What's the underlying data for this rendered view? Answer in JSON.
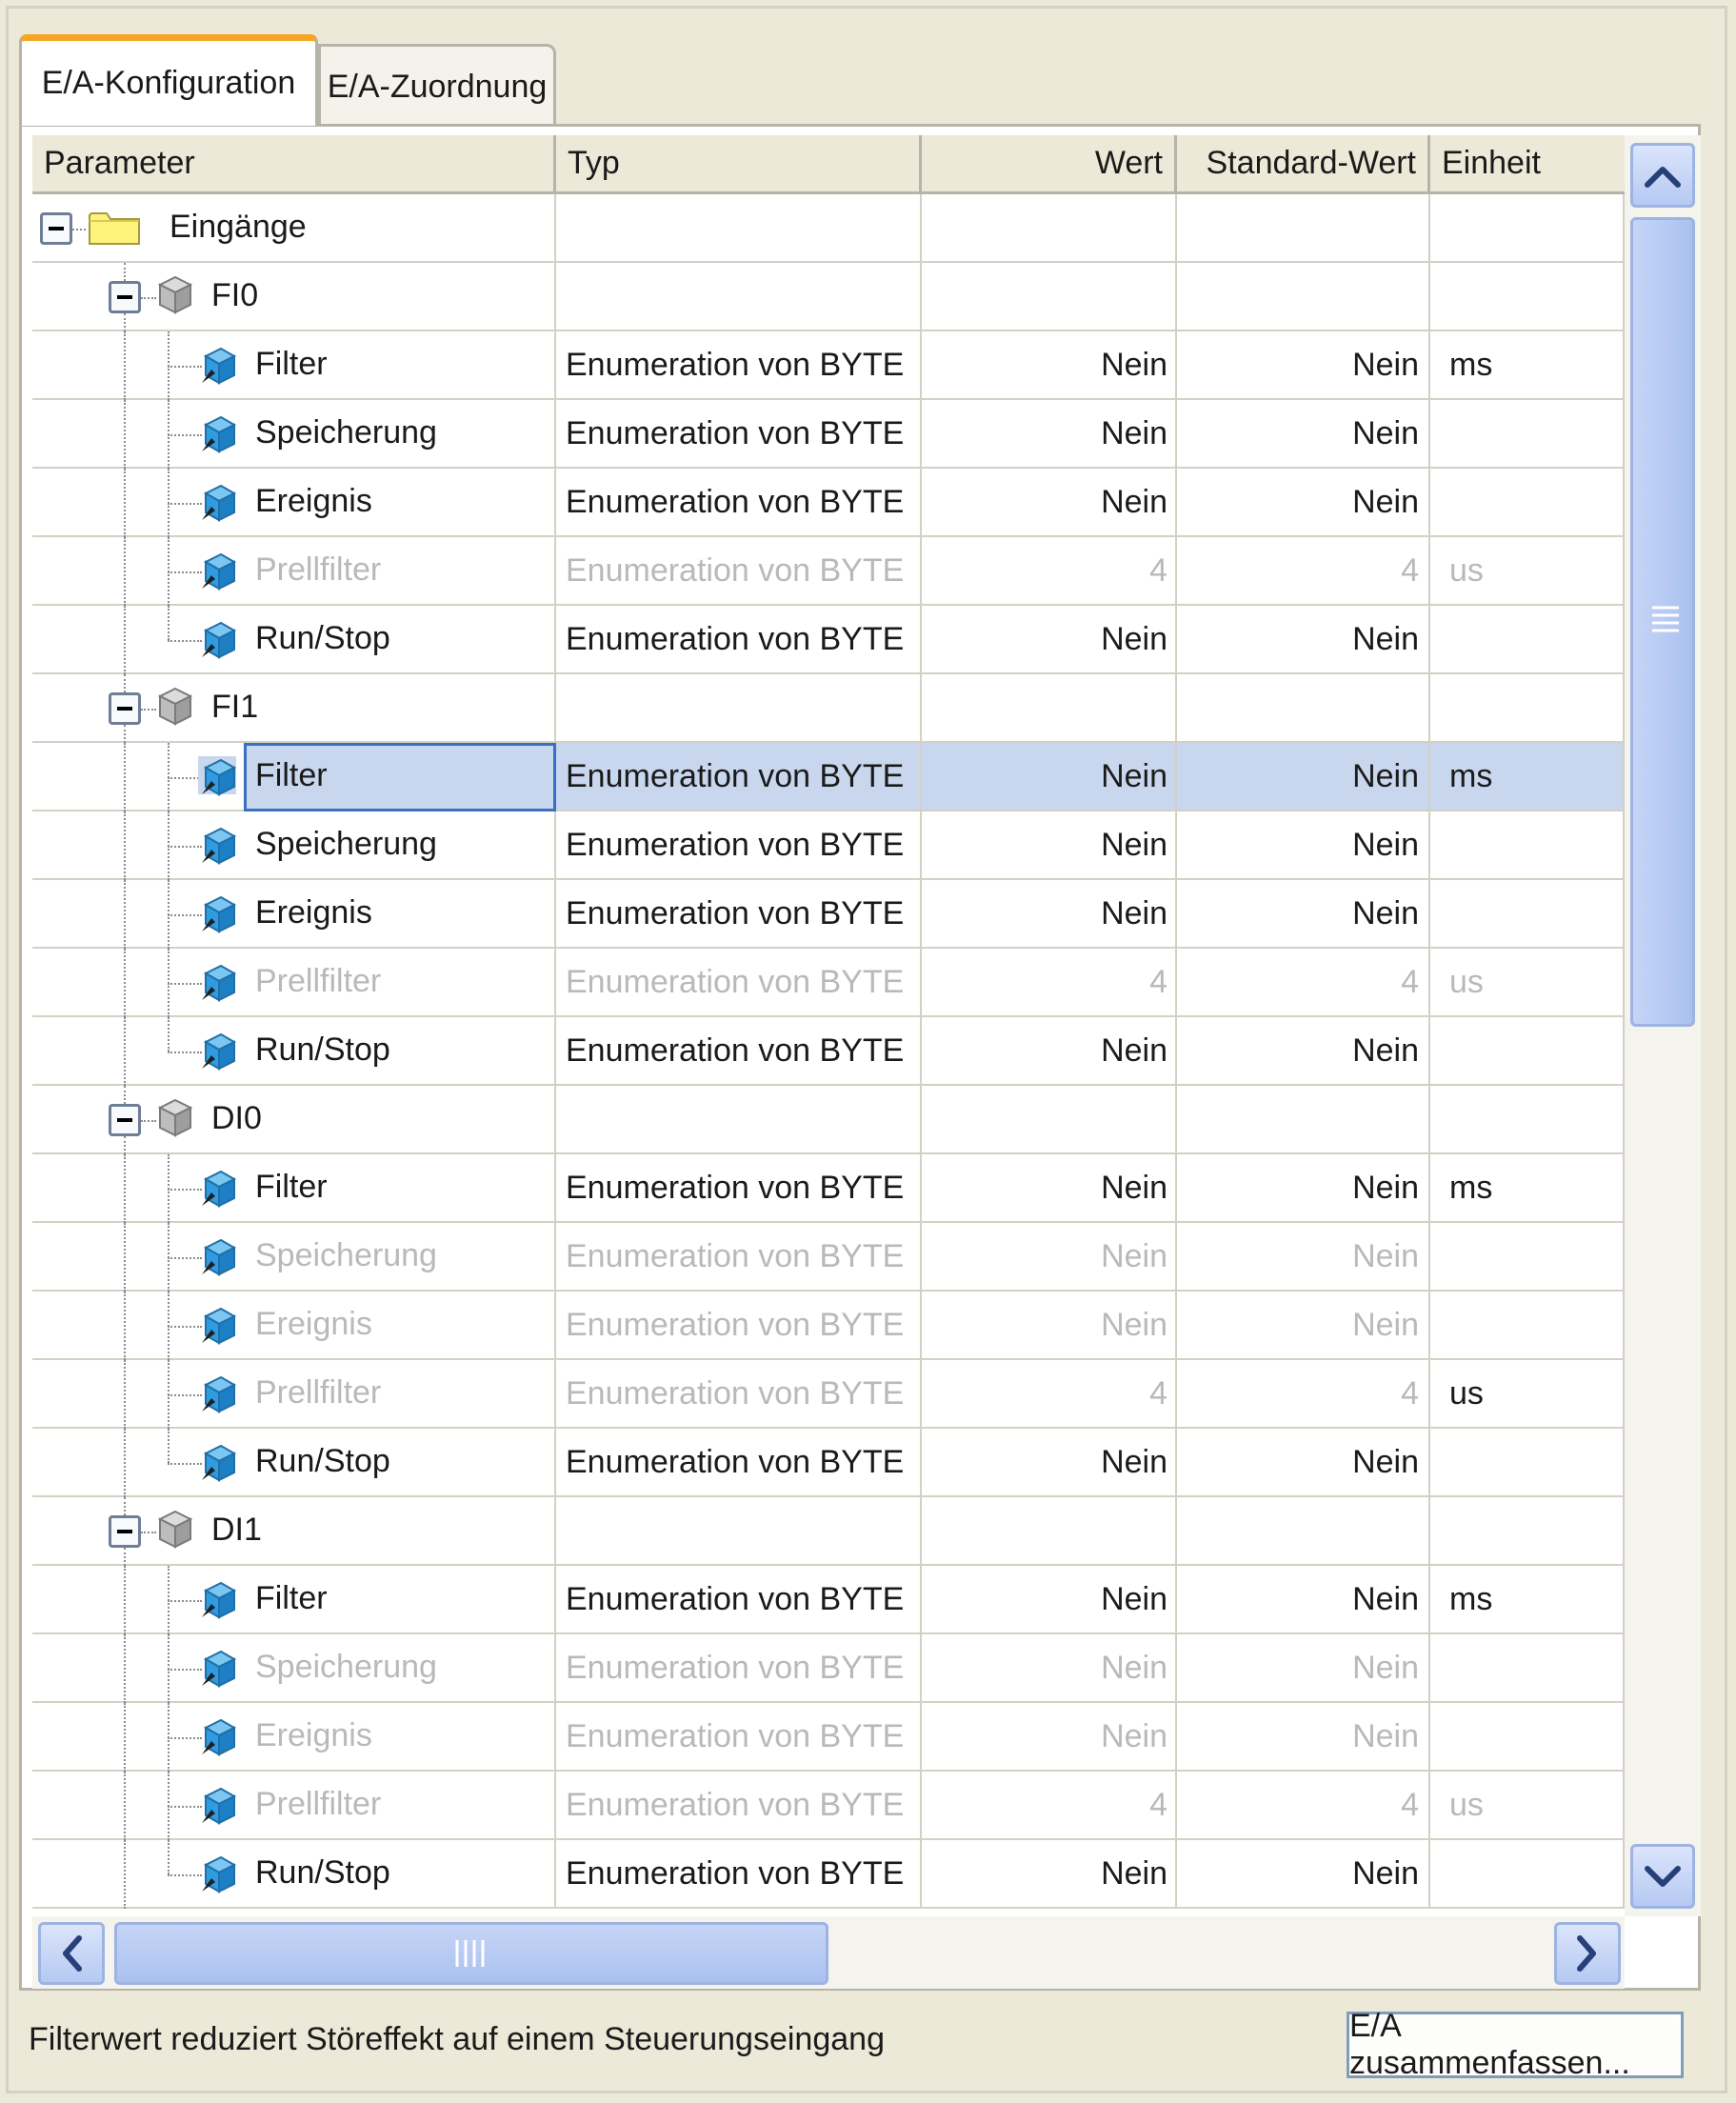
{
  "tabs": [
    {
      "label": "E/A-Konfiguration"
    },
    {
      "label": "E/A-Zuordnung"
    }
  ],
  "columns": {
    "parameter": "Parameter",
    "typ": "Typ",
    "wert": "Wert",
    "standard_wert": "Standard-Wert",
    "einheit": "Einheit"
  },
  "rows": [
    {
      "kind": "root",
      "label": "Eingänge"
    },
    {
      "kind": "group",
      "label": "FI0"
    },
    {
      "kind": "param",
      "label": "Filter",
      "typ": "Enumeration von BYTE",
      "wert": "Nein",
      "std": "Nein",
      "einheit": "ms"
    },
    {
      "kind": "param",
      "label": "Speicherung",
      "typ": "Enumeration von BYTE",
      "wert": "Nein",
      "std": "Nein",
      "einheit": ""
    },
    {
      "kind": "param",
      "label": "Ereignis",
      "typ": "Enumeration von BYTE",
      "wert": "Nein",
      "std": "Nein",
      "einheit": ""
    },
    {
      "kind": "param",
      "label": "Prellfilter",
      "typ": "Enumeration von BYTE",
      "wert": "4",
      "std": "4",
      "einheit": "us",
      "disabled": true
    },
    {
      "kind": "param",
      "label": "Run/Stop",
      "typ": "Enumeration von BYTE",
      "wert": "Nein",
      "std": "Nein",
      "einheit": "",
      "last": true
    },
    {
      "kind": "group",
      "label": "FI1"
    },
    {
      "kind": "param",
      "label": "Filter",
      "typ": "Enumeration von BYTE",
      "wert": "Nein",
      "std": "Nein",
      "einheit": "ms",
      "selected": true
    },
    {
      "kind": "param",
      "label": "Speicherung",
      "typ": "Enumeration von BYTE",
      "wert": "Nein",
      "std": "Nein",
      "einheit": ""
    },
    {
      "kind": "param",
      "label": "Ereignis",
      "typ": "Enumeration von BYTE",
      "wert": "Nein",
      "std": "Nein",
      "einheit": ""
    },
    {
      "kind": "param",
      "label": "Prellfilter",
      "typ": "Enumeration von BYTE",
      "wert": "4",
      "std": "4",
      "einheit": "us",
      "disabled": true
    },
    {
      "kind": "param",
      "label": "Run/Stop",
      "typ": "Enumeration von BYTE",
      "wert": "Nein",
      "std": "Nein",
      "einheit": "",
      "last": true
    },
    {
      "kind": "group",
      "label": "DI0"
    },
    {
      "kind": "param",
      "label": "Filter",
      "typ": "Enumeration von BYTE",
      "wert": "Nein",
      "std": "Nein",
      "einheit": "ms"
    },
    {
      "kind": "param",
      "label": "Speicherung",
      "typ": "Enumeration von BYTE",
      "wert": "Nein",
      "std": "Nein",
      "einheit": "",
      "disabled": true
    },
    {
      "kind": "param",
      "label": "Ereignis",
      "typ": "Enumeration von BYTE",
      "wert": "Nein",
      "std": "Nein",
      "einheit": "",
      "disabled": true
    },
    {
      "kind": "param",
      "label": "Prellfilter",
      "typ": "Enumeration von BYTE",
      "wert": "4",
      "std": "4",
      "einheit": "us",
      "disabled": true,
      "unit_enabled": true
    },
    {
      "kind": "param",
      "label": "Run/Stop",
      "typ": "Enumeration von BYTE",
      "wert": "Nein",
      "std": "Nein",
      "einheit": "",
      "last": true
    },
    {
      "kind": "group",
      "label": "DI1"
    },
    {
      "kind": "param",
      "label": "Filter",
      "typ": "Enumeration von BYTE",
      "wert": "Nein",
      "std": "Nein",
      "einheit": "ms"
    },
    {
      "kind": "param",
      "label": "Speicherung",
      "typ": "Enumeration von BYTE",
      "wert": "Nein",
      "std": "Nein",
      "einheit": "",
      "disabled": true
    },
    {
      "kind": "param",
      "label": "Ereignis",
      "typ": "Enumeration von BYTE",
      "wert": "Nein",
      "std": "Nein",
      "einheit": "",
      "disabled": true
    },
    {
      "kind": "param",
      "label": "Prellfilter",
      "typ": "Enumeration von BYTE",
      "wert": "4",
      "std": "4",
      "einheit": "us",
      "disabled": true
    },
    {
      "kind": "param",
      "label": "Run/Stop",
      "typ": "Enumeration von BYTE",
      "wert": "Nein",
      "std": "Nein",
      "einheit": "",
      "last": true
    }
  ],
  "status_text": "Filterwert reduziert Störeffekt auf einem Steuerungseingang",
  "summary_button": "E/A zusammenfassen...",
  "icons": {
    "root": "folder-icon",
    "group": "gray-cube-icon",
    "param": "blue-cube-icon",
    "expander": "collapse-icon"
  },
  "colors": {
    "active_tab_accent": "#f5a623",
    "selection": "#c9d7ee",
    "disabled_text": "#b9b9b9",
    "scrollbar": "#b6c9f3"
  }
}
